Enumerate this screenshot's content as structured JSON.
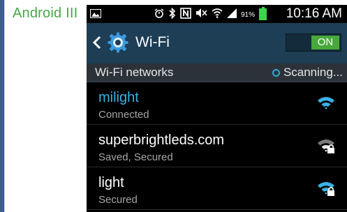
{
  "page_heading": "Android III",
  "status_bar": {
    "battery_percent": "91%",
    "time": "10:16 AM",
    "icons": [
      "picture-icon",
      "alarm-icon",
      "bluetooth-icon",
      "nfc-icon",
      "mute-icon",
      "wifi-signal-icon",
      "cell-signal-icon",
      "battery-icon"
    ]
  },
  "action_bar": {
    "title": "Wi-Fi",
    "toggle_label": "ON"
  },
  "section": {
    "label": "Wi-Fi networks",
    "scanning": "Scanning..."
  },
  "networks": [
    {
      "name": "milight",
      "status": "Connected",
      "connected": true,
      "secured": false
    },
    {
      "name": "superbrightleds.com",
      "status": "Saved, Secured",
      "connected": false,
      "secured": true
    },
    {
      "name": "light",
      "status": "Secured",
      "connected": false,
      "secured": true
    }
  ],
  "colors": {
    "accent": "#38b3e6",
    "action_bar": "#1d3e55",
    "toggle_on": "#48a83c",
    "heading": "#43a843"
  }
}
